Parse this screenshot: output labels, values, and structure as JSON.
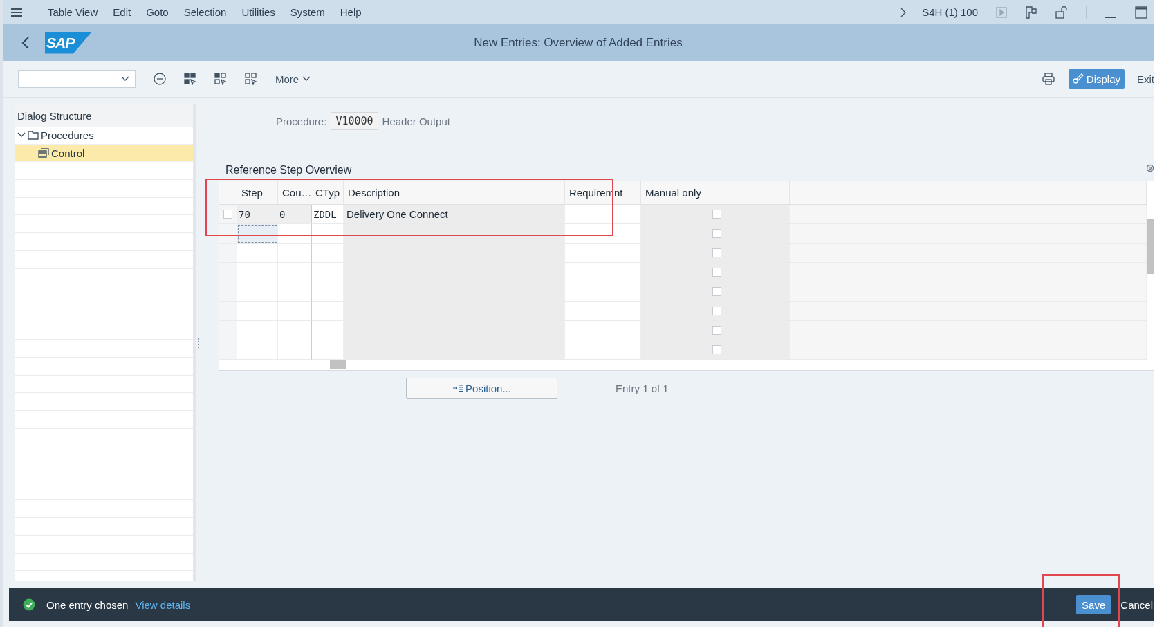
{
  "menu_bar": {
    "items": [
      "Table View",
      "Edit",
      "Goto",
      "Selection",
      "Utilities",
      "System",
      "Help"
    ],
    "system": "S4H (1) 100"
  },
  "title_bar": {
    "logo": "SAP",
    "title": "New Entries: Overview of Added Entries"
  },
  "toolbar": {
    "more": "More",
    "display": "Display",
    "exit": "Exit"
  },
  "dialog_structure": {
    "title": "Dialog Structure",
    "tree": [
      {
        "label": "Procedures",
        "expanded": true,
        "selected": false,
        "children": [
          {
            "label": "Control",
            "selected": true
          }
        ]
      }
    ]
  },
  "procedure": {
    "label": "Procedure:",
    "value": "V10000",
    "description": "Header Output"
  },
  "table": {
    "title": "Reference Step Overview",
    "columns": [
      "Step",
      "Cou…",
      "CTyp",
      "Description",
      "Requiremnt",
      "Manual only"
    ],
    "rows": [
      {
        "kind": "entry",
        "step": "70",
        "counter": "0",
        "ctyp": "ZDDL",
        "description": "Delivery One Connect",
        "manual_only": false,
        "focused": false,
        "selected": false
      },
      {
        "kind": "empty",
        "manual_only": false,
        "focused": true
      },
      {
        "kind": "empty",
        "manual_only": false,
        "focused": false
      },
      {
        "kind": "empty",
        "manual_only": false,
        "focused": false
      },
      {
        "kind": "empty",
        "manual_only": false,
        "focused": false
      },
      {
        "kind": "empty",
        "manual_only": false,
        "focused": false
      },
      {
        "kind": "empty",
        "manual_only": false,
        "focused": false
      },
      {
        "kind": "empty",
        "manual_only": false,
        "focused": false
      }
    ]
  },
  "position_button": "Position...",
  "entry_info": "Entry 1 of 1",
  "status_bar": {
    "message": "One entry chosen",
    "link": "View details",
    "buttons": [
      {
        "kind": "primary",
        "label": "Save"
      },
      {
        "kind": "plain",
        "label": "Cancel"
      }
    ]
  }
}
